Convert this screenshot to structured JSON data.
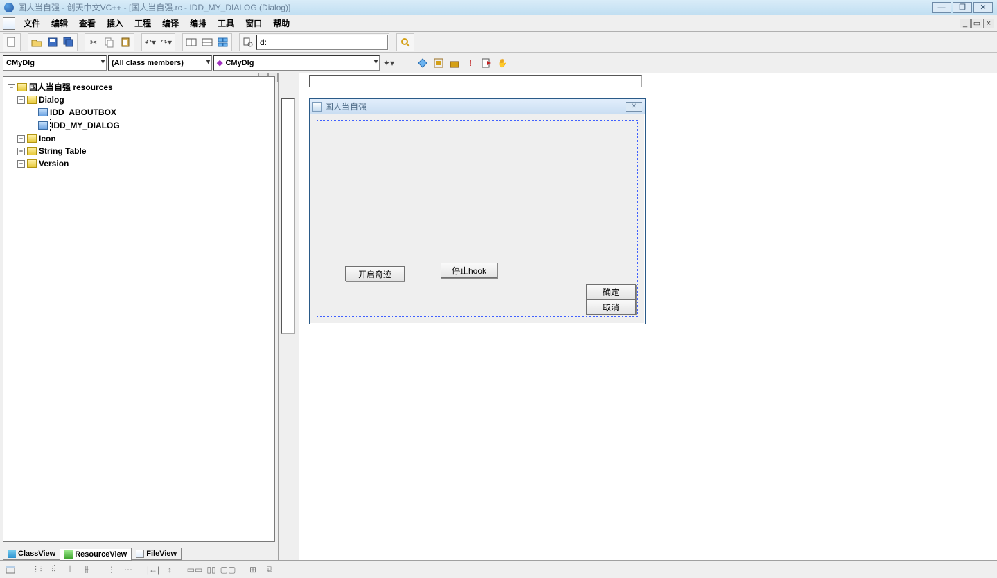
{
  "window": {
    "title": "国人当自强 - 创天中文VC++ - [国人当自强.rc - IDD_MY_DIALOG (Dialog)]"
  },
  "menu": {
    "items": [
      "文件",
      "编辑",
      "查看",
      "插入",
      "工程",
      "编译",
      "编排",
      "工具",
      "窗口",
      "帮助"
    ]
  },
  "toolbar1": {
    "path_value": "d:"
  },
  "toolbar2": {
    "combo1": "CMyDlg",
    "combo2": "(All class members)",
    "combo3": "CMyDlg"
  },
  "tree": {
    "root": "国人当自强 resources",
    "dialog_label": "Dialog",
    "dlg_about": "IDD_ABOUTBOX",
    "dlg_my": "IDD_MY_DIALOG",
    "icon_label": "Icon",
    "string_label": "String Table",
    "version_label": "Version"
  },
  "left_tabs": {
    "class": "ClassView",
    "resource": "ResourceView",
    "file": "FileView"
  },
  "dialog_editor": {
    "title": "国人当自强",
    "btn_start": "开启奇迹",
    "btn_stop": "停止hook",
    "btn_ok": "确定",
    "btn_cancel": "取消"
  }
}
